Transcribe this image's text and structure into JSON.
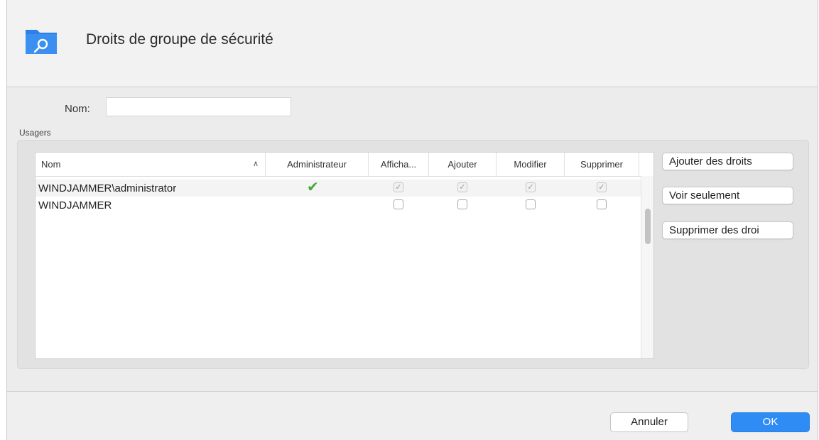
{
  "dialog": {
    "title": "Droits de groupe de sécurité",
    "icon": "folder-key-icon"
  },
  "form": {
    "name_label": "Nom:",
    "name_value": "",
    "users_label": "Usagers"
  },
  "table": {
    "columns": [
      "Nom",
      "Administrateur",
      "Afficha...",
      "Ajouter",
      "Modifier",
      "Supprimer"
    ],
    "sort_indicator": "^",
    "rows": [
      {
        "name": "WINDJAMMER\\administrator",
        "admin": true,
        "view": true,
        "add": true,
        "modify": true,
        "delete": true
      },
      {
        "name": "WINDJAMMER",
        "admin": false,
        "view": false,
        "add": false,
        "modify": false,
        "delete": false
      }
    ]
  },
  "side_buttons": {
    "add_rights": "Ajouter des droits",
    "view_only": "Voir seulement",
    "remove_rights": "Supprimer des droi"
  },
  "footer": {
    "cancel": "Annuler",
    "ok": "OK"
  },
  "colors": {
    "accent": "#2f8cf5",
    "admin_check": "#46a832",
    "folder_icon": "#2f7fe6"
  }
}
